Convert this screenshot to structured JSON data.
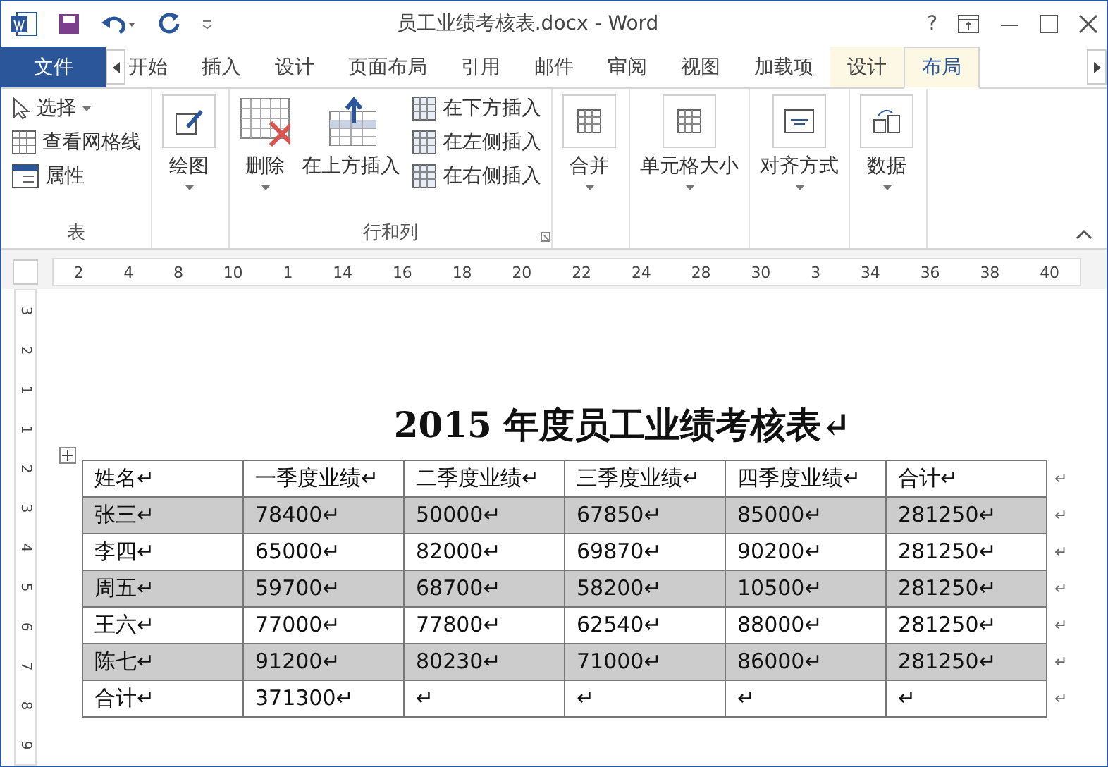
{
  "window": {
    "title": "员工业绩考核表.docx - Word",
    "help": "?"
  },
  "tabs": [
    {
      "label": "文件",
      "kind": "file",
      "selected": false
    },
    {
      "label": "开始",
      "kind": "normal",
      "selected": false
    },
    {
      "label": "插入",
      "kind": "normal",
      "selected": false
    },
    {
      "label": "设计",
      "kind": "normal",
      "selected": false
    },
    {
      "label": "页面布局",
      "kind": "normal",
      "selected": false
    },
    {
      "label": "引用",
      "kind": "normal",
      "selected": false
    },
    {
      "label": "邮件",
      "kind": "normal",
      "selected": false
    },
    {
      "label": "审阅",
      "kind": "normal",
      "selected": false
    },
    {
      "label": "视图",
      "kind": "normal",
      "selected": false
    },
    {
      "label": "加载项",
      "kind": "normal",
      "selected": false
    },
    {
      "label": "设计",
      "kind": "context",
      "selected": false
    },
    {
      "label": "布局",
      "kind": "context",
      "selected": true
    }
  ],
  "ribbon": {
    "groups": [
      {
        "label": "表",
        "items": [
          {
            "label": "选择",
            "kind": "small",
            "dropdown": true
          },
          {
            "label": "查看网格线",
            "kind": "small",
            "dropdown": false
          },
          {
            "label": "属性",
            "kind": "small",
            "dropdown": false
          }
        ]
      },
      {
        "items": [
          {
            "label": "绘图",
            "kind": "boxed",
            "dropdown": true
          }
        ]
      },
      {
        "label": "行和列",
        "launcher": true,
        "items": [
          {
            "label": "删除",
            "kind": "large",
            "dropdown": true
          },
          {
            "label": "在上方插入",
            "kind": "large",
            "dropdown": false
          },
          {
            "label": "在下方插入",
            "kind": "small",
            "dropdown": false
          },
          {
            "label": "在左侧插入",
            "kind": "small",
            "dropdown": false
          },
          {
            "label": "在右侧插入",
            "kind": "small",
            "dropdown": false
          }
        ]
      },
      {
        "items": [
          {
            "label": "合并",
            "kind": "boxed",
            "dropdown": true
          }
        ]
      },
      {
        "items": [
          {
            "label": "单元格大小",
            "kind": "boxed",
            "dropdown": true
          }
        ]
      },
      {
        "items": [
          {
            "label": "对齐方式",
            "kind": "boxed",
            "dropdown": true
          }
        ]
      },
      {
        "items": [
          {
            "label": "数据",
            "kind": "boxed",
            "dropdown": true
          }
        ]
      }
    ]
  },
  "ruler": {
    "numbers": [
      "2",
      "4",
      "8",
      "10",
      "1",
      "14",
      "16",
      "18",
      "20",
      "22",
      "24",
      "28",
      "30",
      "3",
      "34",
      "36",
      "38",
      "40"
    ],
    "vertical_numbers": [
      "3",
      "2",
      "1",
      "1",
      "2",
      "3",
      "4",
      "5",
      "6",
      "7",
      "8",
      "9"
    ]
  },
  "document": {
    "title": "2015 年度员工业绩考核表↵",
    "table": {
      "rows": [
        {
          "shaded": false,
          "cells": [
            "姓名↵",
            "一季度业绩↵",
            "二季度业绩↵",
            "三季度业绩↵",
            "四季度业绩↵",
            "合计↵"
          ],
          "end_mark": "↵"
        },
        {
          "shaded": true,
          "cells": [
            "张三↵",
            "78400↵",
            "50000↵",
            "67850↵",
            "85000↵",
            "281250↵"
          ],
          "end_mark": "↵"
        },
        {
          "shaded": false,
          "cells": [
            "李四↵",
            "65000↵",
            "82000↵",
            "69870↵",
            "90200↵",
            "281250↵"
          ],
          "end_mark": "↵"
        },
        {
          "shaded": true,
          "cells": [
            "周五↵",
            "59700↵",
            "68700↵",
            "58200↵",
            "10500↵",
            "281250↵"
          ],
          "end_mark": "↵"
        },
        {
          "shaded": false,
          "cells": [
            "王六↵",
            "77000↵",
            "77800↵",
            "62540↵",
            "88000↵",
            "281250↵"
          ],
          "end_mark": "↵"
        },
        {
          "shaded": true,
          "cells": [
            "陈七↵",
            "91200↵",
            "80230↵",
            "71000↵",
            "86000↵",
            "281250↵"
          ],
          "end_mark": "↵"
        },
        {
          "shaded": false,
          "cells": [
            "合计↵",
            "371300↵",
            "↵",
            "↵",
            "↵",
            "↵"
          ],
          "end_mark": "↵"
        }
      ]
    }
  }
}
